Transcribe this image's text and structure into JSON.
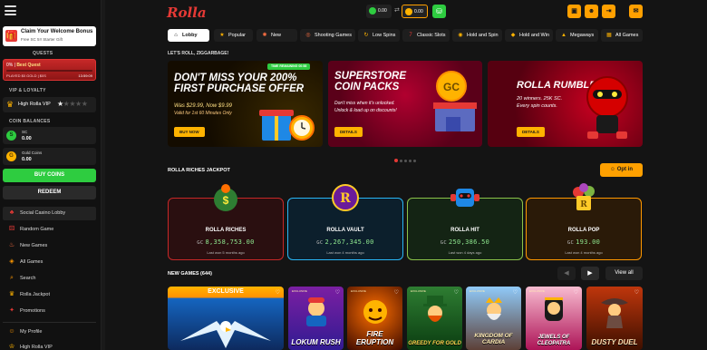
{
  "sidebar": {
    "welcome": {
      "title": "Claim Your Welcome Bonus",
      "subtitle": "Free SC 5!! Starter Gift"
    },
    "quests_label": "QUESTS",
    "quest": {
      "progress": "0%",
      "name": "Best Quest",
      "played": "PLAYED $0 GOLD | $0S",
      "timer": "13:59:09"
    },
    "vip_label": "VIP & LOYALTY",
    "vip": {
      "name": "High Rolla VIP",
      "stars_filled": 1,
      "stars_total": 5
    },
    "coin_balances_label": "COIN BALANCES",
    "balances": [
      {
        "label": "SC",
        "value": "0.00",
        "color": "#2ecc40"
      },
      {
        "label": "Gold Coins",
        "value": "0.00",
        "color": "#ffb300"
      }
    ],
    "buy_label": "BUY COINS",
    "redeem_label": "REDEEM",
    "nav": [
      {
        "label": "Social Casino Lobby",
        "icon": "casino-icon",
        "glyph": "♣"
      },
      {
        "label": "Random Game",
        "icon": "random-icon",
        "glyph": "🎲"
      },
      {
        "label": "New Games",
        "icon": "flame-icon",
        "glyph": "🔥"
      },
      {
        "label": "All Games",
        "icon": "grid-icon",
        "glyph": "◈"
      },
      {
        "label": "Search",
        "icon": "search-icon",
        "glyph": "⌕"
      },
      {
        "label": "Rolla Jackpot",
        "icon": "jackpot-icon",
        "glyph": "♛"
      },
      {
        "label": "Promotions",
        "icon": "promo-icon",
        "glyph": "✦"
      },
      {
        "label": "My Profile",
        "icon": "profile-icon",
        "glyph": "☺"
      },
      {
        "label": "High Rolla VIP",
        "icon": "vip-icon",
        "glyph": "♔"
      }
    ]
  },
  "header": {
    "logo": "Rolla",
    "sc_balance": "0.00",
    "gc_balance": "0.00",
    "icons": [
      "wallet-icon",
      "user-icon",
      "logout-icon",
      "chat-icon"
    ]
  },
  "tabs": [
    {
      "label": "Lobby",
      "icon": "lobby-icon",
      "glyph": "⌂"
    },
    {
      "label": "Popular",
      "icon": "star-icon",
      "glyph": "★"
    },
    {
      "label": "New",
      "icon": "new-icon",
      "glyph": "✺"
    },
    {
      "label": "Shooting Games",
      "icon": "target-icon",
      "glyph": "◎"
    },
    {
      "label": "Low Spins",
      "icon": "spin-icon",
      "glyph": "↻"
    },
    {
      "label": "Classic Slots",
      "icon": "slot-icon",
      "glyph": "7"
    },
    {
      "label": "Hold and Spin",
      "icon": "hold-icon",
      "glyph": "◉"
    },
    {
      "label": "Hold and Win",
      "icon": "win-icon",
      "glyph": "◆"
    },
    {
      "label": "Megaways",
      "icon": "mega-icon",
      "glyph": "▲"
    },
    {
      "label": "All Games",
      "icon": "all-icon",
      "glyph": "▦"
    }
  ],
  "greeting": "LET'S ROLL, ZIGGARBAGE!",
  "banners": [
    {
      "title": "DON'T MISS YOUR 200% FIRST PURCHASE OFFER",
      "sub1": "Was $29.99, Now $9.99",
      "sub2": "Valid for 1st 60 Minutes Only",
      "badge": "TIME REMAINING 00:58",
      "button": "BUY NOW"
    },
    {
      "title": "SUPERSTORE COIN PACKS",
      "sub1": "Don't miss when it's unlocked.",
      "sub2": "Unlock & load up on discounts!",
      "button": "DETAILS"
    },
    {
      "title": "ROLLA RUMBLE",
      "sub1": "20 winners. 25K SC.",
      "sub2": "Every spin counts.",
      "button": "DETAILS"
    }
  ],
  "jackpot": {
    "title": "ROLLA RICHES JACKPOT",
    "optin_label": "Opt in",
    "currency": "GC",
    "cards": [
      {
        "name": "ROLLA RICHES",
        "value": "8,358,753.00",
        "won": "Last won 5 months ago",
        "border": "#c62828"
      },
      {
        "name": "ROLLA VAULT",
        "value": "2,267,345.00",
        "won": "Last won 4 months ago",
        "border": "#29b6f6"
      },
      {
        "name": "ROLLA HIT",
        "value": "250,386.50",
        "won": "Last won 4 days ago",
        "border": "#8bc34a"
      },
      {
        "name": "ROLLA POP",
        "value": "193.00",
        "won": "Last won 4 months ago",
        "border": "#ff9800"
      }
    ]
  },
  "new_games": {
    "title": "NEW GAMES (644)",
    "view_all": "View all",
    "tiles": [
      {
        "name": "",
        "ribbon": "EXCLUSIVE"
      },
      {
        "name": "LOKUM RUSH",
        "ribbon": "EXCLUSIVE"
      },
      {
        "name": "FIRE ERUPTION",
        "ribbon": "EXCLUSIVE"
      },
      {
        "name": "GREEDY FOR GOLD",
        "ribbon": "EXCLUSIVE"
      },
      {
        "name": "KINGDOM OF CARDIA",
        "ribbon": "EXCLUSIVE"
      },
      {
        "name": "JEWELS OF CLEOPATRA",
        "ribbon": "EXCLUSIVE"
      },
      {
        "name": "DUSTY DUEL",
        "ribbon": ""
      }
    ]
  },
  "colors": {
    "accent": "#ffa000",
    "brand": "#e53935",
    "green": "#2ecc40"
  }
}
